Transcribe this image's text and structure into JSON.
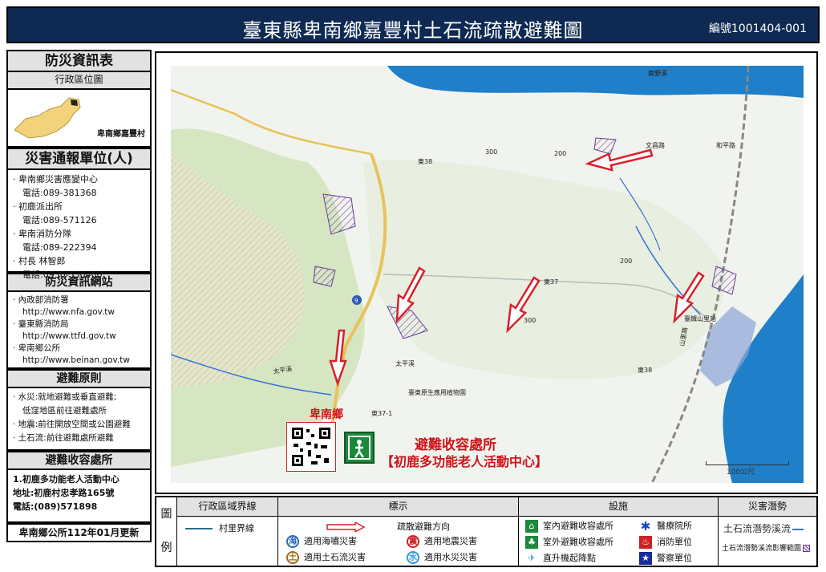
{
  "header": {
    "title": "臺東縣卑南鄉嘉豐村土石流疏散避難圖",
    "code": "編號1001404-001"
  },
  "sidebar": {
    "info_title": "防災資訊表",
    "admin_title": "行政區位圖",
    "admin_label": "卑南鄉嘉豐村",
    "report_title": "災害通報單位(人)",
    "report_lines": [
      "· 卑南鄉災害應變中心",
      "  電話:089-381368",
      "· 初鹿派出所",
      "  電話:089-571126",
      "· 卑南消防分隊",
      "  電話:089-222394",
      "· 村長 林智郎",
      "  電話:0930-530400"
    ],
    "web_title": "防災資訊網站",
    "web_lines": [
      "· 內政部消防署",
      "  http://www.nfa.gov.tw",
      "· 臺東縣消防局",
      "  http://www.ttfd.gov.tw",
      "· 卑南鄉公所",
      "  http://www.beinan.gov.tw"
    ],
    "principle_title": "避難原則",
    "principle_lines": [
      "· 水災:就地避難或垂直避難;",
      "    低窪地區前往避難處所",
      "· 地震:前往開放空間或公園避難",
      "· 土石流:前往避難處所避難"
    ],
    "shelter_title": "避難收容處所",
    "shelter_lines": [
      "1.初鹿多功能老人活動中心",
      "  地址:初鹿村忠孝路165號",
      "  電話:(089)571898"
    ],
    "footer": "卑南鄉公所112年01月更新"
  },
  "map": {
    "labels": {
      "township": "卑南鄉",
      "river1": "鹿野溪",
      "river2": "太平溪",
      "road1": "文昌路",
      "road2": "和平路",
      "road3": "山里路",
      "station": "臺鐵山里站",
      "site": "臺東原生應用植物園",
      "r38": "東38",
      "r37": "東37",
      "r37_1": "東37-1",
      "r9": "9",
      "e300": "300",
      "e200": "200",
      "e300b": "300",
      "e200b": "200"
    },
    "shelter_title": "避難收容處所",
    "shelter_name": "【初鹿多功能老人活動中心】",
    "scale": "100公尺",
    "colors": {
      "river": "#3a6fd8",
      "sea": "#1f7fc8",
      "arrow": "#d81f2a",
      "debris": "#6a3a9a",
      "road": "#e8c25a"
    }
  },
  "legend": {
    "tu": "圖",
    "li": "例",
    "col_admin": "行政區域界線",
    "col_sign": "標示",
    "col_facility": "設施",
    "col_potential": "災害潛勢",
    "village_line": "村里界線",
    "evac_dir": "疏散避難方向",
    "tsunami": "適用海嘯災害",
    "quake": "適用地震災害",
    "debris": "適用土石流災害",
    "flood": "適用水災災害",
    "tsunami_sym": "海",
    "quake_sym": "震",
    "debris_sym": "土",
    "flood_sym": "水",
    "indoor": "室內避難收容處所",
    "outdoor": "室外避難收容處所",
    "heli": "直升機起降點",
    "hospital": "醫療院所",
    "fire": "消防單位",
    "police": "警察單位",
    "stream": "土石流潛勢溪流",
    "stream_zone": "土石流潛勢溪流影響範圍"
  }
}
